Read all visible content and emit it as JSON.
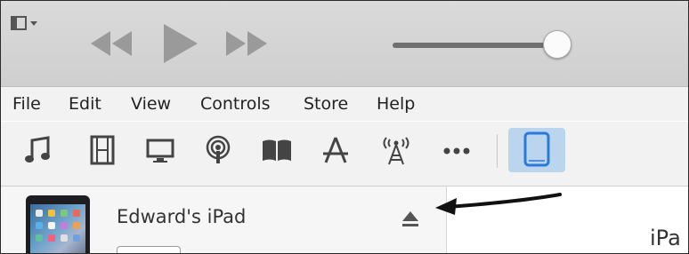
{
  "menu": {
    "items": [
      {
        "label": "File"
      },
      {
        "label": "Edit"
      },
      {
        "label": "View"
      },
      {
        "label": "Controls"
      },
      {
        "label": "Store"
      },
      {
        "label": "Help"
      }
    ]
  },
  "player": {
    "volume_level": 0.9
  },
  "media_bar": {
    "icons": [
      "music-icon",
      "movies-icon",
      "tv-icon",
      "podcasts-icon",
      "books-icon",
      "apps-icon",
      "radio-icon",
      "more-icon",
      "device-icon"
    ],
    "selected": "device-icon"
  },
  "device": {
    "name": "Edward's iPad"
  },
  "main": {
    "label": "iPa"
  },
  "colors": {
    "selected_bg": "#bcd5ee",
    "device_icon": "#2a7ad6",
    "toolbar_bg": "#d4d4d4"
  }
}
